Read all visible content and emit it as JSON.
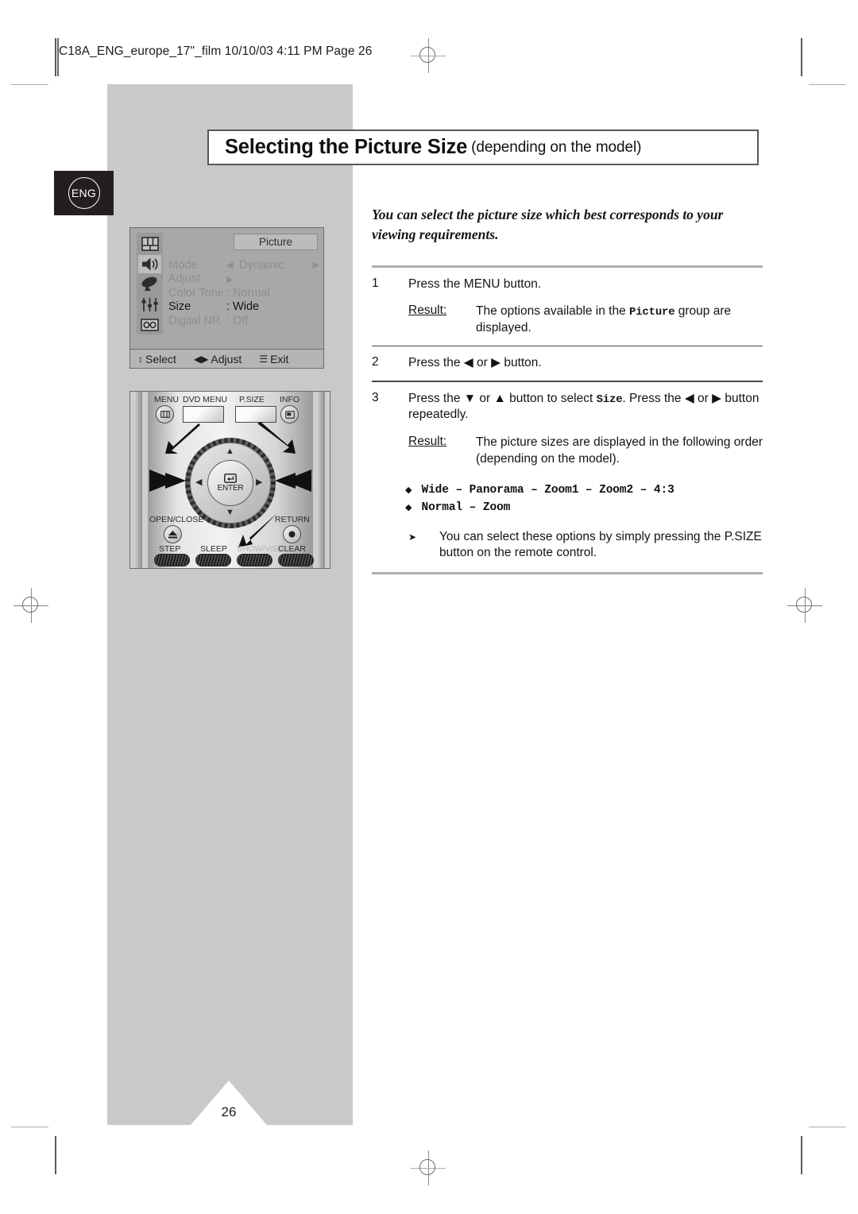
{
  "page_header": "C18A_ENG_europe_17\"_film  10/10/03  4:11 PM  Page 26",
  "lang_badge": "ENG",
  "page_number": "26",
  "title": {
    "main": "Selecting the Picture Size",
    "sub": "(depending on the model)"
  },
  "intro": "You can select the picture size which best corresponds to your viewing requirements.",
  "osd": {
    "tab": "Picture",
    "icons": [
      "screen-grid-icon",
      "speaker-icon",
      "satellite-dish-icon",
      "sliders-icon",
      "setup-icon"
    ],
    "rows": [
      {
        "label": "Mode",
        "left_arrow": "◀",
        "value": "Dynamic",
        "right_arrow": "▶",
        "active": false
      },
      {
        "label": "Adjust",
        "left_arrow": "",
        "value": "▶",
        "right_arrow": "",
        "active": false
      },
      {
        "label": "Color Tone",
        "left_arrow": "",
        "value": ": Normal",
        "right_arrow": "",
        "active": false
      },
      {
        "label": "Size",
        "left_arrow": "",
        "value": ": Wide",
        "right_arrow": "",
        "active": true
      },
      {
        "label": "Digital NR",
        "left_arrow": "",
        "value": ": Off",
        "right_arrow": "",
        "active": false
      }
    ],
    "footer": [
      {
        "glyph": "↕",
        "label": "Select"
      },
      {
        "glyph": "◀▶",
        "label": "Adjust"
      },
      {
        "glyph": "☰",
        "label": "Exit"
      }
    ]
  },
  "remote": {
    "top_labels": [
      "MENU",
      "DVD MENU",
      "P.SIZE",
      "INFO"
    ],
    "mid_labels": [
      "OPEN/CLOSE",
      "RETURN"
    ],
    "enter_label": "ENTER",
    "bottom_labels": [
      "STEP",
      "SLEEP",
      "SHOW/VIEW",
      "CLEAR"
    ]
  },
  "steps": [
    {
      "num": "1",
      "text_pre": "Press the MENU button.",
      "result_label": "Result:",
      "result_pre": "The options available in the ",
      "result_mono": "Picture",
      "result_post": " group are displayed."
    },
    {
      "num": "2",
      "text_pre": "Press the ◀ or ▶ button."
    },
    {
      "num": "3",
      "text_pre": "Press the ▼ or ▲ button to select ",
      "text_mono": "Size",
      "text_post": ". Press the ◀ or ▶ button repeatedly.",
      "result_label": "Result:",
      "result_pre": "The picture sizes are displayed in the following order (depending on the model).",
      "bullets": [
        {
          "marker": "◆",
          "text": "Wide – Panorama – Zoom1 – Zoom2 – 4:3"
        },
        {
          "marker": "◆",
          "text": "Normal – Zoom"
        }
      ]
    }
  ],
  "note": {
    "marker": "➤",
    "text": "You can select these options by simply pressing the P.SIZE button on the remote control."
  }
}
